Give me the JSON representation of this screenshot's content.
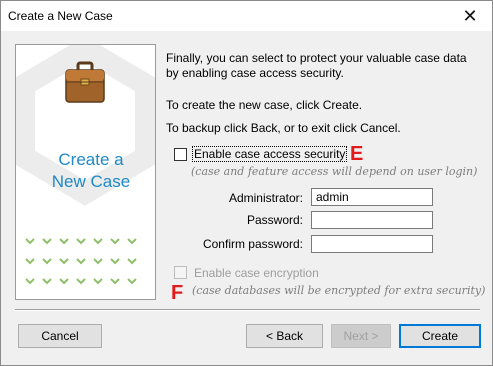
{
  "window": {
    "title": "Create a New Case"
  },
  "banner": {
    "text": "Create a\nNew Case"
  },
  "content": {
    "intro": "Finally, you can select to protect your valuable case data\nby enabling case access security.",
    "line_create": "To create the new case, click Create.",
    "line_back": "To backup click Back, or to exit click Cancel."
  },
  "security": {
    "checkbox_label": "Enable case access security",
    "checked": false,
    "note": "(case and feature access will depend on user login)",
    "administrator_label": "Administrator:",
    "administrator_value": "admin",
    "password_label": "Password:",
    "password_value": "",
    "confirm_label": "Confirm password:",
    "confirm_value": ""
  },
  "encryption": {
    "checkbox_label": "Enable case encryption",
    "checked": false,
    "enabled": false,
    "note": "(case databases will be encrypted for extra security)"
  },
  "markers": {
    "e": "E",
    "f": "F"
  },
  "buttons": {
    "cancel": "Cancel",
    "back": "< Back",
    "next": "Next >",
    "create": "Create"
  },
  "colors": {
    "banner_text": "#1e8ac7",
    "marker": "#e11b1b",
    "default_button_border": "#0078d7"
  }
}
